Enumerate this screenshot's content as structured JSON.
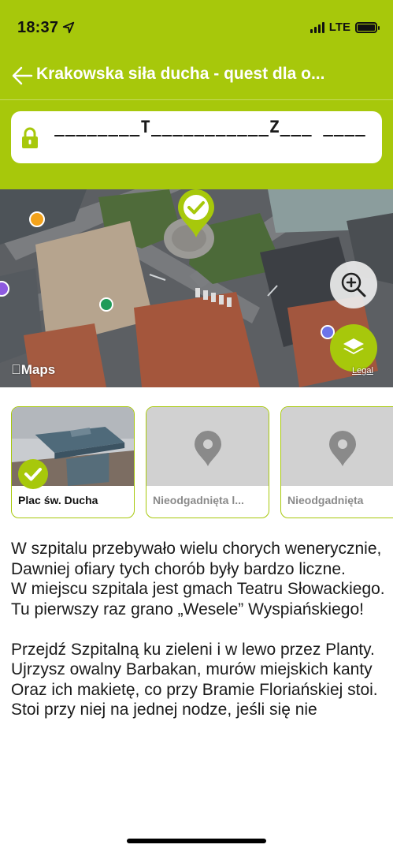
{
  "status_bar": {
    "time": "18:37",
    "network": "LTE",
    "icons": [
      "location-arrow-icon",
      "signal-icon",
      "battery-icon"
    ]
  },
  "nav": {
    "title": "Krakowska siła ducha - quest dla o...",
    "back_icon": "back-arrow-icon"
  },
  "answer": {
    "icon": "lock-icon",
    "text": "________T___________Z___ ____"
  },
  "map": {
    "attribution": "Maps",
    "legal_label": "Legal",
    "zoom_icon": "zoom-in-icon",
    "layers_icon": "layers-icon",
    "pin_icon": "checkmark-pin-icon"
  },
  "places": [
    {
      "label": "Plac św. Ducha",
      "solved": true
    },
    {
      "label": "Nieodgadnięta l...",
      "solved": false
    },
    {
      "label": "Nieodgadnięta",
      "solved": false
    }
  ],
  "content": {
    "text": "W szpitalu przebywało wielu chorych wenerycznie,\nDawniej ofiary tych chorób były bardzo liczne.\nW miejscu szpitala jest gmach Teatru Słowackiego.\nTu pierwszy raz grano „Wesele” Wyspiańskiego!\n\nPrzejdź Szpitalną ku zieleni i w lewo przez Planty.\nUjrzysz owalny Barbakan, murów miejskich kanty\nOraz ich makietę, co przy Bramie Floriańskiej stoi.\nStoi przy niej na jednej nodze, jeśli się nie"
  },
  "colors": {
    "accent": "#a7c80b",
    "text": "#1a1a1a",
    "muted": "#8a8a8a"
  }
}
